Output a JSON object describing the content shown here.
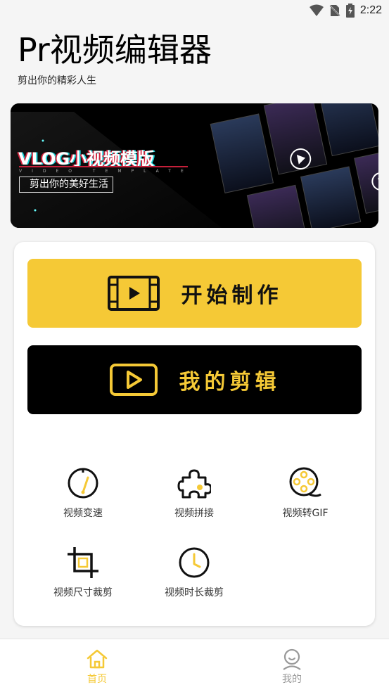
{
  "status_bar": {
    "time": "2:22",
    "icons": [
      "wifi-icon",
      "no-sim-icon",
      "battery-charging-icon"
    ]
  },
  "header": {
    "title": "Pr视频编辑器",
    "subtitle": "剪出你的精彩人生"
  },
  "banner": {
    "title": "VLOG小视频模版",
    "subtitle_en": "VIDEO TEMPLATE",
    "tagline": "剪出你的美好生活"
  },
  "actions": {
    "start": {
      "label": "开始制作",
      "icon": "film-play-icon"
    },
    "mine": {
      "label": "我的剪辑",
      "icon": "play-box-icon"
    }
  },
  "tools": [
    {
      "label": "视频变速",
      "icon": "speedometer-icon"
    },
    {
      "label": "视频拼接",
      "icon": "puzzle-icon"
    },
    {
      "label": "视频转GIF",
      "icon": "film-reel-icon"
    },
    {
      "label": "视频尺寸裁剪",
      "icon": "crop-icon"
    },
    {
      "label": "视频时长裁剪",
      "icon": "clock-icon"
    }
  ],
  "tabbar": {
    "items": [
      {
        "label": "首页",
        "icon": "home-icon",
        "active": true
      },
      {
        "label": "我的",
        "icon": "user-icon",
        "active": false
      }
    ]
  },
  "colors": {
    "accent": "#f5c936",
    "dark": "#000000",
    "inactive": "#999999"
  }
}
